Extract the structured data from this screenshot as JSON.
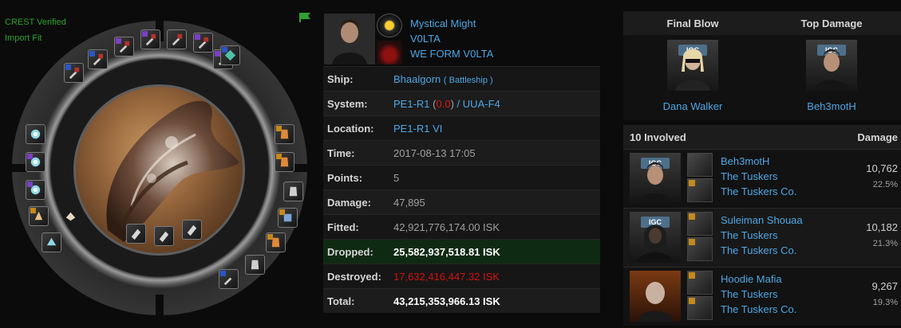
{
  "verification": {
    "crest": "CREST Verified",
    "import_fit": "Import Fit"
  },
  "icons": {
    "flag": "flag-icon",
    "high_slot_module": "weapon-module-icon",
    "mid_slot_module": "shield-module-icon",
    "low_slot_module": "armor-module-icon",
    "rig_module": "rig-icon",
    "drone": "drone-icon",
    "ship_type": "ship-icon"
  },
  "colors": {
    "link": "#4ea7e4",
    "crest_green": "#2fa02f",
    "dropped_bg": "#0f2a12",
    "destroyed": "#d41111",
    "security_red": "#e01515"
  },
  "victim": {
    "character": "Mystical Might",
    "corporation": "V0LTA",
    "alliance": "WE FORM V0LTA"
  },
  "details": {
    "ship_label": "Ship:",
    "ship_name": "Bhaalgorn",
    "ship_class": "Battleship",
    "system_label": "System:",
    "system_name": "PE1-R1",
    "system_security": "0.0",
    "system_region": "UUA-F4",
    "location_label": "Location:",
    "location_value": "PE1-R1 VI",
    "time_label": "Time:",
    "time_value": "2017-08-13 17:05",
    "points_label": "Points:",
    "points_value": "5",
    "damage_label": "Damage:",
    "damage_value": "47,895",
    "fitted_label": "Fitted:",
    "fitted_value": "42,921,776,174.00 ISK",
    "dropped_label": "Dropped:",
    "dropped_value": "25,582,937,518.81 ISK",
    "destroyed_label": "Destroyed:",
    "destroyed_value": "17,632,416,447.32 ISK",
    "total_label": "Total:",
    "total_value": "43,215,353,966.13 ISK"
  },
  "final_blow": {
    "header_final": "Final Blow",
    "header_top": "Top Damage",
    "final_name": "Dana Walker",
    "top_name": "Beh3motH",
    "portrait_badge": "IGC"
  },
  "involved": {
    "header_count": "10 Involved",
    "header_damage": "Damage",
    "rows": [
      {
        "name": "Beh3motH",
        "corp": "The Tuskers",
        "alliance": "The Tuskers Co.",
        "damage": "10,762",
        "percent": "22.5%",
        "badge": "IGC"
      },
      {
        "name": "Suleiman Shouaa",
        "corp": "The Tuskers",
        "alliance": "The Tuskers Co.",
        "damage": "10,182",
        "percent": "21.3%",
        "badge": "IGC"
      },
      {
        "name": "Hoodie Mafia",
        "corp": "The Tuskers",
        "alliance": "The Tuskers Co.",
        "damage": "9,267",
        "percent": "19.3%",
        "badge": ""
      }
    ]
  }
}
